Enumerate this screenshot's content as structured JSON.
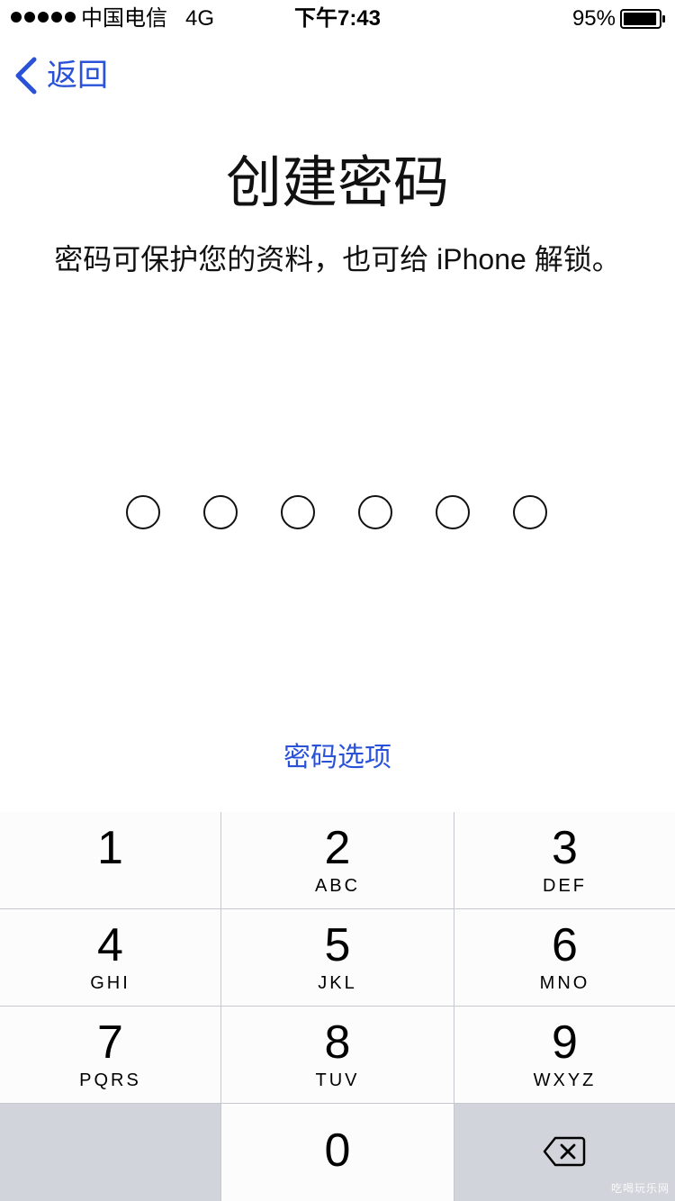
{
  "status_bar": {
    "carrier": "中国电信",
    "network": "4G",
    "time": "下午7:43",
    "battery_percent": "95%",
    "battery_level": 0.95
  },
  "nav": {
    "back_label": "返回",
    "back_icon": "chevron-left-icon"
  },
  "content": {
    "title": "创建密码",
    "subtitle": "密码可保护您的资料，也可给 iPhone 解锁。",
    "passcode_length": 6,
    "passcode_entered": 0,
    "options_label": "密码选项"
  },
  "keypad": {
    "keys": [
      {
        "digit": "1",
        "letters": ""
      },
      {
        "digit": "2",
        "letters": "ABC"
      },
      {
        "digit": "3",
        "letters": "DEF"
      },
      {
        "digit": "4",
        "letters": "GHI"
      },
      {
        "digit": "5",
        "letters": "JKL"
      },
      {
        "digit": "6",
        "letters": "MNO"
      },
      {
        "digit": "7",
        "letters": "PQRS"
      },
      {
        "digit": "8",
        "letters": "TUV"
      },
      {
        "digit": "9",
        "letters": "WXYZ"
      },
      {
        "digit": "0",
        "letters": ""
      }
    ],
    "delete_icon": "backspace-icon"
  },
  "watermark": "吃喝玩乐网",
  "colors": {
    "accent": "#2952d9",
    "key_background": "#fcfcfd",
    "function_key_background": "#d1d4da",
    "keypad_separator": "#c7c9d0"
  }
}
